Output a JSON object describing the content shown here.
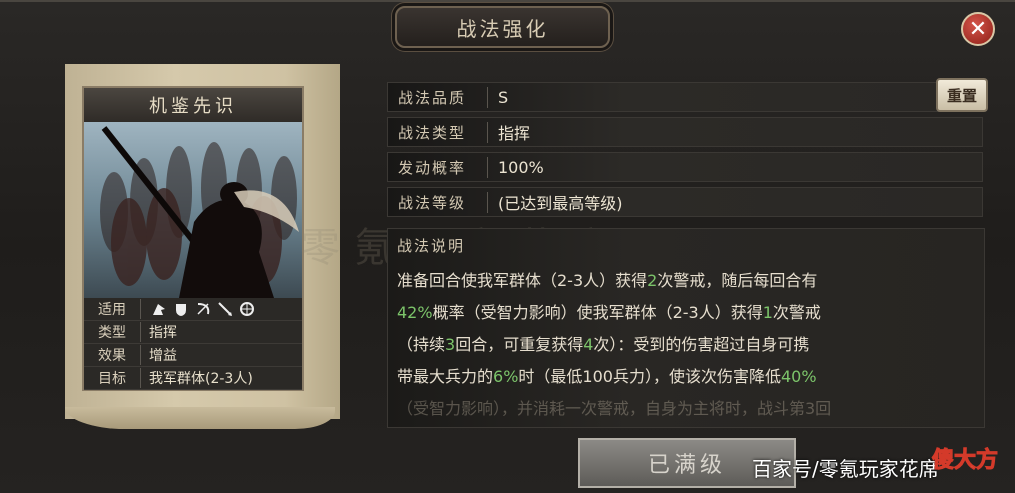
{
  "window": {
    "title": "战法强化",
    "close_icon": "close-icon"
  },
  "card": {
    "name": "机鉴先识",
    "props": [
      {
        "key": "适用",
        "icons": [
          "cavalry-icon",
          "shield-icon",
          "bow-icon",
          "spear-icon",
          "wheel-icon"
        ]
      },
      {
        "key": "类型",
        "value": "指挥"
      },
      {
        "key": "效果",
        "value": "增益"
      },
      {
        "key": "目标",
        "value": "我军群体(2-3人)"
      }
    ]
  },
  "info": {
    "quality_label": "战法品质",
    "quality_value": "S",
    "type_label": "战法类型",
    "type_value": "指挥",
    "rate_label": "发动概率",
    "rate_value": "100%",
    "level_label": "战法等级",
    "level_value": "(已达到最高等级)",
    "reset_label": "重置"
  },
  "description": {
    "title": "战法说明",
    "watermark": "零氪玩家花席",
    "lines": [
      [
        {
          "t": "准备回合使我军群体（2-3人）获得"
        },
        {
          "t": "2",
          "hl": true
        },
        {
          "t": "次警戒，随后每回合有"
        }
      ],
      [
        {
          "t": "42%",
          "hl": true
        },
        {
          "t": "概率（受智力影响）使我军群体（2-3人）获得"
        },
        {
          "t": "1",
          "hl": true
        },
        {
          "t": "次警戒"
        }
      ],
      [
        {
          "t": "（持续"
        },
        {
          "t": "3",
          "hl": true
        },
        {
          "t": "回合，可重复获得"
        },
        {
          "t": "4",
          "hl": true
        },
        {
          "t": "次）：受到的伤害超过自身可携"
        }
      ],
      [
        {
          "t": "带最大兵力的"
        },
        {
          "t": "6%",
          "hl": true
        },
        {
          "t": "时（最低100兵力），使该次伤害降低"
        },
        {
          "t": "40%",
          "hl": true
        }
      ],
      [
        {
          "t": "（受智力影响），并消耗一次警戒，自身为主将时，战斗第3回",
          "fade": true
        }
      ]
    ]
  },
  "max_button": {
    "label": "已满级"
  },
  "source": {
    "text": "百家号/零氪玩家花席",
    "logo_text": "傻大方"
  }
}
